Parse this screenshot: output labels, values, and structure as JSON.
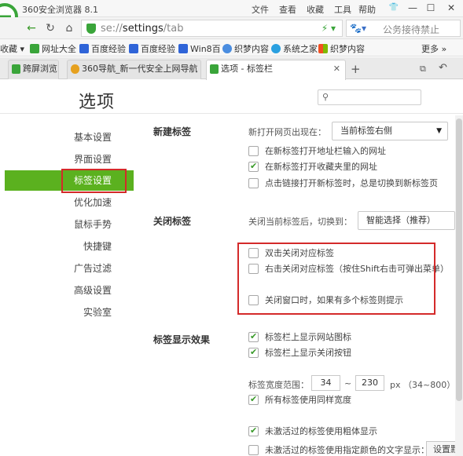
{
  "window": {
    "title": "360安全浏览器 8.1",
    "menu": [
      "文件",
      "查看",
      "收藏",
      "工具",
      "帮助"
    ],
    "controls": {
      "minimize": "—",
      "maximize": "☐",
      "close": "✕"
    }
  },
  "address_bar": {
    "url_prefix": "se://",
    "url_path": "settings",
    "url_suffix": "/tab",
    "search_text": "公务接待禁止"
  },
  "bookmarks": {
    "items": [
      {
        "label": "收藏",
        "icon": "star-icon"
      },
      {
        "label": "网址大全",
        "icon": "site-icon"
      },
      {
        "label": "百度经验",
        "icon": "baidu-paw-icon"
      },
      {
        "label": "百度经验",
        "icon": "baidu-paw-icon"
      },
      {
        "label": "Win8百",
        "icon": "baidu-paw-icon"
      },
      {
        "label": "织梦内容",
        "icon": "dedecms-icon"
      },
      {
        "label": "系统之家",
        "icon": "xitong-icon"
      },
      {
        "label": "织梦内容",
        "icon": "windows-icon"
      }
    ],
    "more_label": "更多"
  },
  "tabs": [
    {
      "label": "跨屏浏览",
      "active": false
    },
    {
      "label": "360导航_新一代安全上网导航",
      "active": false
    },
    {
      "label": "选项 - 标签栏",
      "active": true
    }
  ],
  "page": {
    "title": "选项",
    "search_placeholder": ""
  },
  "nav": {
    "items": [
      "基本设置",
      "界面设置",
      "标签设置",
      "优化加速",
      "鼠标手势",
      "快捷键",
      "广告过滤",
      "高级设置",
      "实验室"
    ],
    "active_index": 2
  },
  "new_tab": {
    "title": "新建标签",
    "open_label": "新打开网页出现在：",
    "open_value": "当前标签右侧",
    "options": [
      {
        "label": "在新标签打开地址栏输入的网址",
        "checked": false
      },
      {
        "label": "在新标签打开收藏夹里的网址",
        "checked": true
      },
      {
        "label": "点击链接打开新标签时，总是切换到新标签页",
        "checked": false
      }
    ]
  },
  "close_tab": {
    "title": "关闭标签",
    "switch_label": "关闭当前标签后，切换到：",
    "switch_value": "智能选择（推荐）",
    "options": [
      {
        "label": "双击关闭对应标签",
        "checked": false
      },
      {
        "label": "右击关闭对应标签（按住Shift右击可弹出菜单）",
        "checked": false
      },
      {
        "label": "关闭窗口时，如果有多个标签则提示",
        "checked": false
      }
    ]
  },
  "tab_display": {
    "title": "标签显示效果",
    "options": [
      {
        "label": "标签栏上显示网站图标",
        "checked": true
      },
      {
        "label": "标签栏上显示关闭按钮",
        "checked": true
      }
    ],
    "width_label": "标签宽度范围：",
    "width_min": "34",
    "width_sep": "~",
    "width_max": "230",
    "width_unit": "px （34~800）",
    "same_width": {
      "label": "所有标签使用同样宽度",
      "checked": true
    },
    "bold_inactive": {
      "label": "未激活过的标签使用粗体显示",
      "checked": true
    },
    "color_inactive": {
      "label": "未激活过的标签使用指定颜色的文字显示：",
      "checked": false
    },
    "set_default_label": "设置默认"
  }
}
